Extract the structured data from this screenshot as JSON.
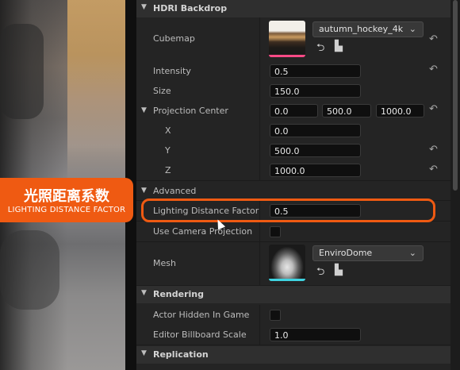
{
  "overlay": {
    "title_cn": "光照距离系数",
    "title_en": "LIGHTING DISTANCE FACTOR",
    "accent_color": "#ef5a12"
  },
  "sections": {
    "hdri_backdrop": "HDRI Backdrop",
    "advanced": "Advanced",
    "rendering": "Rendering",
    "replication": "Replication"
  },
  "hdri": {
    "cubemap": {
      "label": "Cubemap",
      "value": "autumn_hockey_4k",
      "thumbnail": "autumn-hockey-thumbnail",
      "browse_icon": "arrow-left-circle-icon",
      "folder_icon": "folder-search-icon"
    },
    "intensity": {
      "label": "Intensity",
      "value": "0.5"
    },
    "size": {
      "label": "Size",
      "value": "150.0"
    },
    "projection_center": {
      "label": "Projection Center",
      "values": [
        "0.0",
        "500.0",
        "1000.0"
      ],
      "x": {
        "label": "X",
        "value": "0.0"
      },
      "y": {
        "label": "Y",
        "value": "500.0"
      },
      "z": {
        "label": "Z",
        "value": "1000.0"
      }
    }
  },
  "advanced": {
    "lighting_distance_factor": {
      "label": "Lighting Distance Factor",
      "value": "0.5"
    },
    "use_camera_projection": {
      "label": "Use Camera Projection",
      "checked": false
    },
    "mesh": {
      "label": "Mesh",
      "value": "EnviroDome",
      "thumbnail": "dome-mesh-thumbnail"
    }
  },
  "rendering": {
    "actor_hidden_in_game": {
      "label": "Actor Hidden In Game",
      "checked": false
    },
    "editor_billboard_scale": {
      "label": "Editor Billboard Scale",
      "value": "1.0"
    }
  },
  "icons": {
    "collapse": "triangle-down-icon",
    "reset": "reset-arrow-icon",
    "dropdown": "chevron-down-icon"
  }
}
